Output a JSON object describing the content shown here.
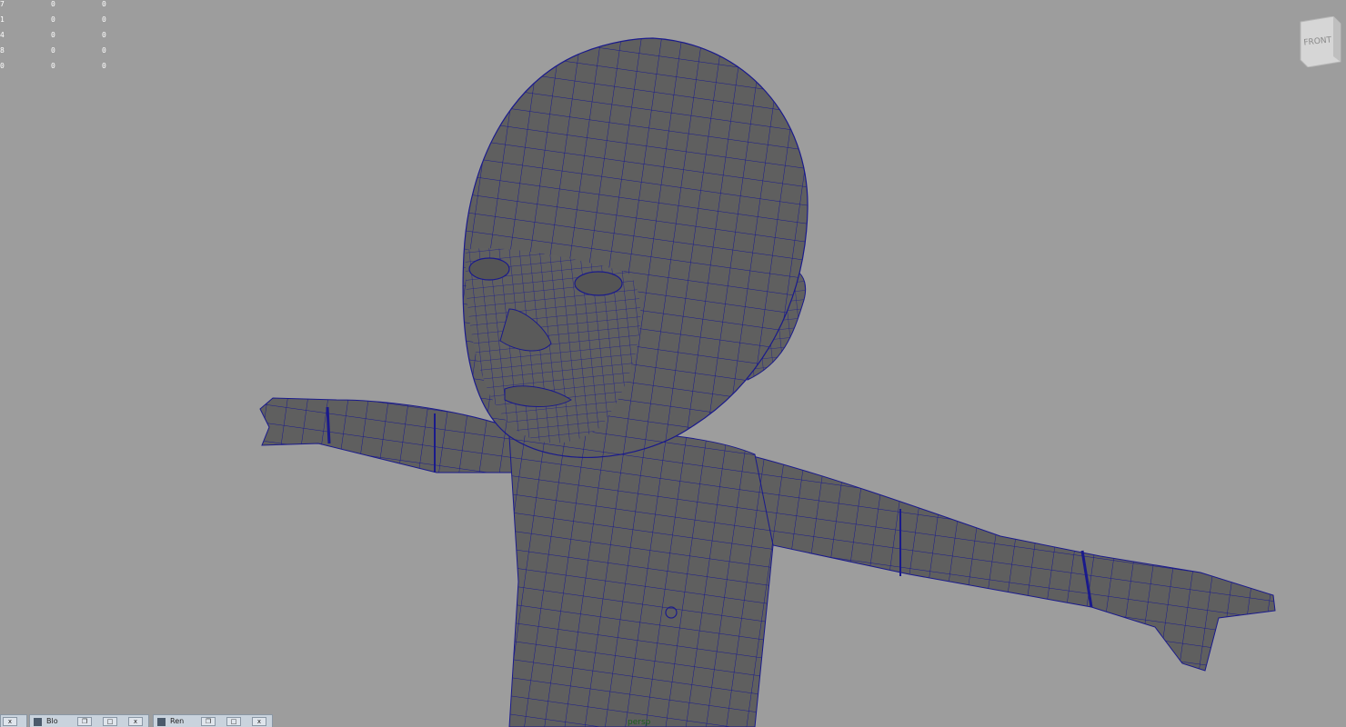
{
  "viewport": {
    "camera_label": "persp",
    "background_color": "#9d9d9d",
    "wire_color": "#1a1a8c",
    "mesh_color": "#5f5f5f"
  },
  "hud_rows": [
    [
      "7",
      "0",
      "0"
    ],
    [
      "1",
      "0",
      "0"
    ],
    [
      "4",
      "0",
      "0"
    ],
    [
      "8",
      "0",
      "0"
    ],
    [
      "0",
      "0",
      "0"
    ]
  ],
  "viewcube": {
    "face_label": "FRONT"
  },
  "taskbar": {
    "windows": [
      {
        "label": "Blo",
        "icon": "window-icon"
      },
      {
        "label": "Ren",
        "icon": "window-icon"
      }
    ]
  }
}
